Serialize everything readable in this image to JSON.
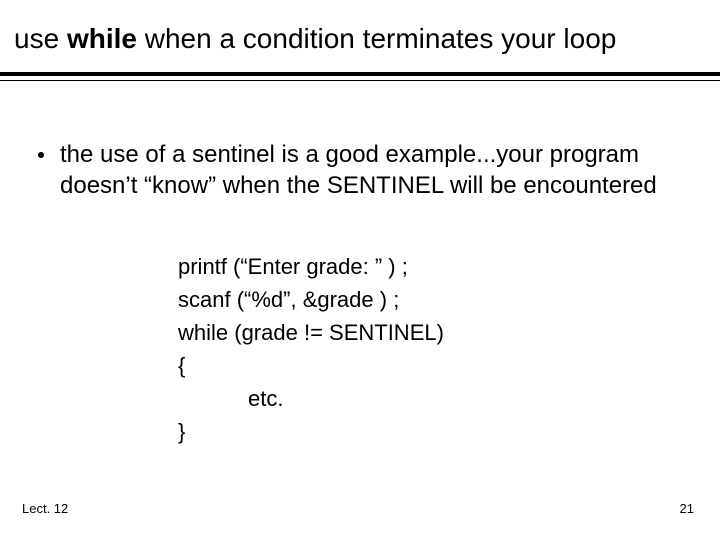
{
  "title": {
    "pre": "use ",
    "bold": "while",
    "post": " when a condition terminates your loop"
  },
  "bullet": "the use of a sentinel is a good example...your program doesn’t “know” when the SENTINEL will be encountered",
  "code": {
    "l1": "printf (“Enter grade: ” ) ;",
    "l2": "scanf (“%d”, &grade ) ;",
    "l3": "while (grade != SENTINEL)",
    "l4": "{",
    "l5": "etc.",
    "l6": "}"
  },
  "footer": {
    "left": "Lect. 12",
    "right": "21"
  }
}
